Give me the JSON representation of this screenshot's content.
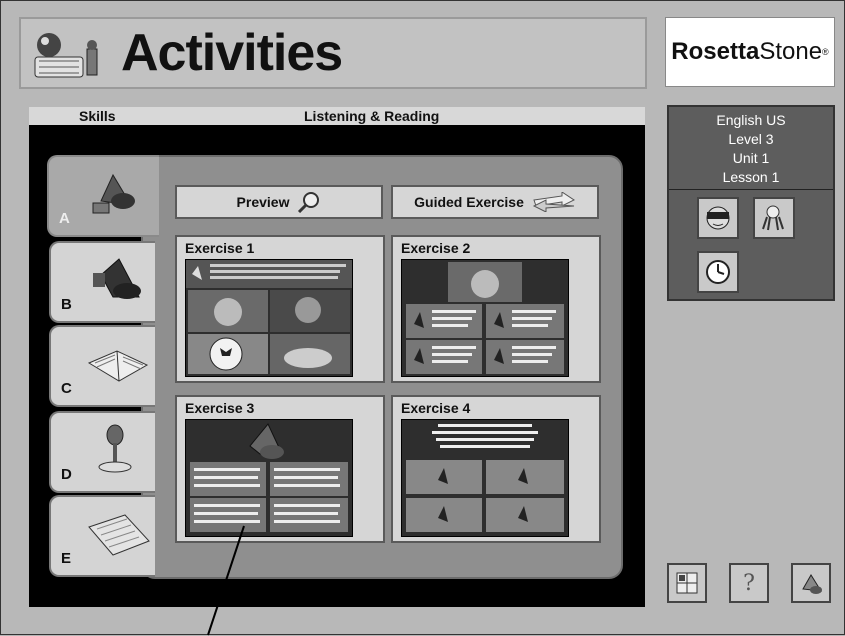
{
  "title": "Activities",
  "logo": {
    "bold": "Rosetta",
    "regular": "Stone",
    "mark": "®"
  },
  "header": {
    "skills_label": "Skills",
    "module_label": "Listening & Reading"
  },
  "tabs": [
    {
      "letter": "A",
      "icon": "speaker-icon",
      "active": true
    },
    {
      "letter": "B",
      "icon": "speaker-icon",
      "active": false
    },
    {
      "letter": "C",
      "icon": "book-icon",
      "active": false
    },
    {
      "letter": "D",
      "icon": "microphone-icon",
      "active": false
    },
    {
      "letter": "E",
      "icon": "keyboard-icon",
      "active": false
    }
  ],
  "actions": {
    "preview": {
      "label": "Preview",
      "icon": "magnifier-icon"
    },
    "guided": {
      "label": "Guided Exercise",
      "icon": "arrows-icon"
    }
  },
  "exercises": [
    {
      "title": "Exercise 1"
    },
    {
      "title": "Exercise 2"
    },
    {
      "title": "Exercise 3"
    },
    {
      "title": "Exercise 4"
    }
  ],
  "course": {
    "language": "English US",
    "level": "Level 3",
    "unit": "Unit 1",
    "lesson": "Lesson 1"
  },
  "side_tools": [
    "face-icon",
    "hand-icon",
    "clock-icon"
  ],
  "bottom_tools": {
    "grid": "grid-icon",
    "help": "?",
    "speaker": "speaker-icon"
  }
}
